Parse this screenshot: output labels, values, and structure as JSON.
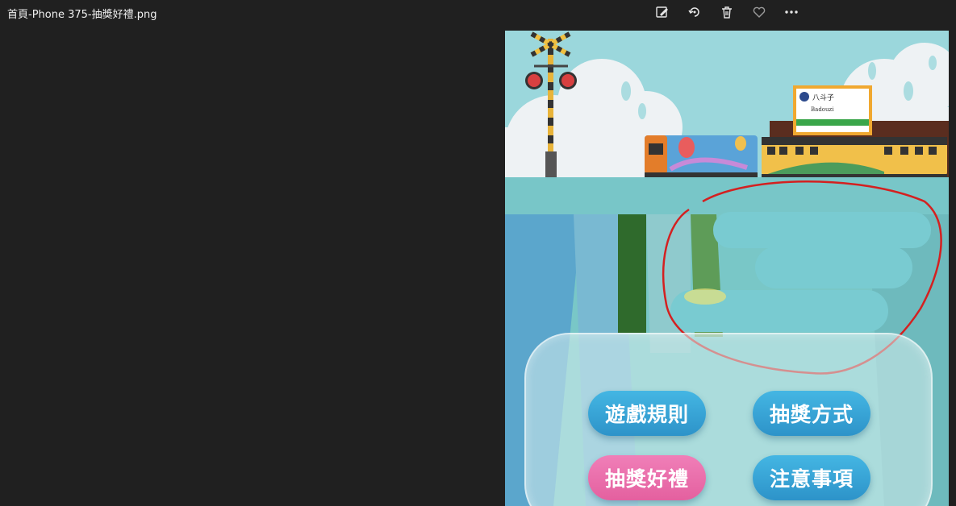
{
  "window": {
    "filename": "首頁-Phone 375-抽獎好禮.png"
  },
  "toolbar": {
    "icons": [
      "edit-image-icon",
      "rotate-icon",
      "delete-icon",
      "favorite-heart-icon",
      "more-options-icon"
    ]
  },
  "station_sign": {
    "name": "八斗子",
    "romanized": "Badouzi"
  },
  "menu": {
    "rules_label": "遊戲規則",
    "method_label": "抽獎方式",
    "prizes_label": "抽獎好禮",
    "notice_label": "注意事項"
  },
  "colors": {
    "button_blue": "#3aa8db",
    "button_pink": "#ec72ac",
    "annotation_red": "#d42020",
    "viewer_bg": "#202020"
  }
}
